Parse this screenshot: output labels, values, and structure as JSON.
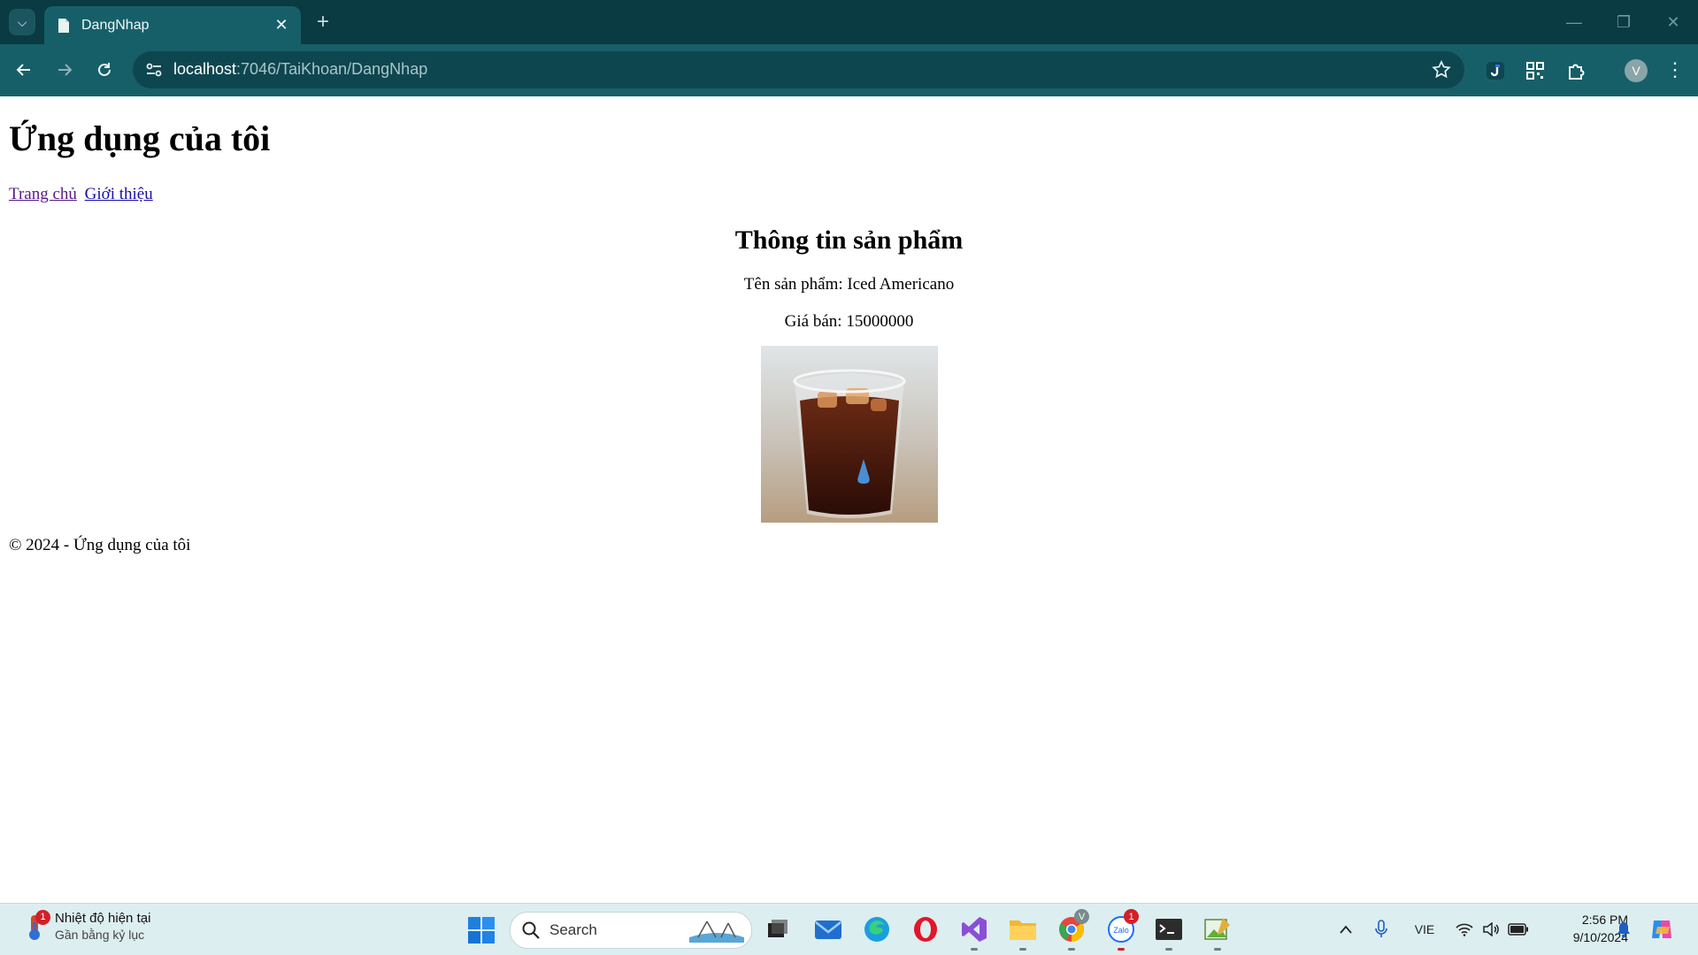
{
  "browser": {
    "tab_title": "DangNhap",
    "url_host": "localhost",
    "url_rest": ":7046/TaiKhoan/DangNhap",
    "profile_initial": "V"
  },
  "page": {
    "app_title": "Ứng dụng của tôi",
    "nav": [
      "Trang chủ",
      "Giới thiệu"
    ],
    "product_heading": "Thông tin sản phẩm",
    "product_name_line": "Tên sản phẩm: Iced Americano",
    "product_price_line": "Giá bán: 15000000",
    "footer": "© 2024 - Ứng dụng của tôi"
  },
  "taskbar": {
    "weather_title": "Nhiệt độ hiện tại",
    "weather_subtitle": "Gần bằng kỷ lục",
    "weather_badge": "1",
    "search_label": "Search",
    "zalo_badge": "1",
    "chrome_badge": "V",
    "language": "VIE",
    "time": "2:56 PM",
    "date": "9/10/2024"
  },
  "colors": {
    "tabstrip": "#0a3a42",
    "toolbar": "#175f68",
    "link": "#1a0dab",
    "taskbar": "#dceef0"
  }
}
